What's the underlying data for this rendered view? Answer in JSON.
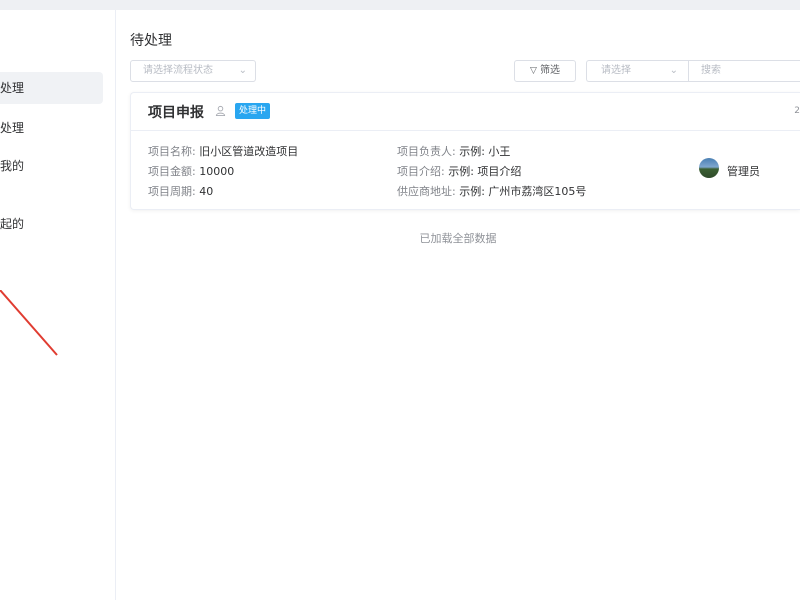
{
  "sidebar": {
    "items": [
      {
        "label": "处理",
        "active": true
      },
      {
        "label": "处理",
        "active": false
      },
      {
        "label": "我的",
        "active": false
      },
      {
        "label": "起的",
        "active": false
      }
    ]
  },
  "main": {
    "title": "待处理",
    "toolbar": {
      "status_placeholder": "请选择流程状态",
      "filter_label": "筛选",
      "select_placeholder": "请选择",
      "search_placeholder": "搜索"
    }
  },
  "card": {
    "title": "项目申报",
    "status": "处理中",
    "corner_text": "2",
    "fields": {
      "name_label": "项目名称:",
      "name_value": "旧小区管道改造项目",
      "amount_label": "项目金额:",
      "amount_value": "10000",
      "period_label": "项目周期:",
      "period_value": "40",
      "owner_label": "项目负责人:",
      "owner_value": "示例: 小王",
      "intro_label": "项目介绍:",
      "intro_value": "示例: 项目介绍",
      "supplier_label": "供应商地址:",
      "supplier_value": "示例: 广州市荔湾区105号"
    },
    "assignee": "管理员"
  },
  "footer": {
    "loaded_all": "已加载全部数据"
  },
  "colors": {
    "accent": "#29a6f0",
    "arrow": "#e03c31"
  }
}
